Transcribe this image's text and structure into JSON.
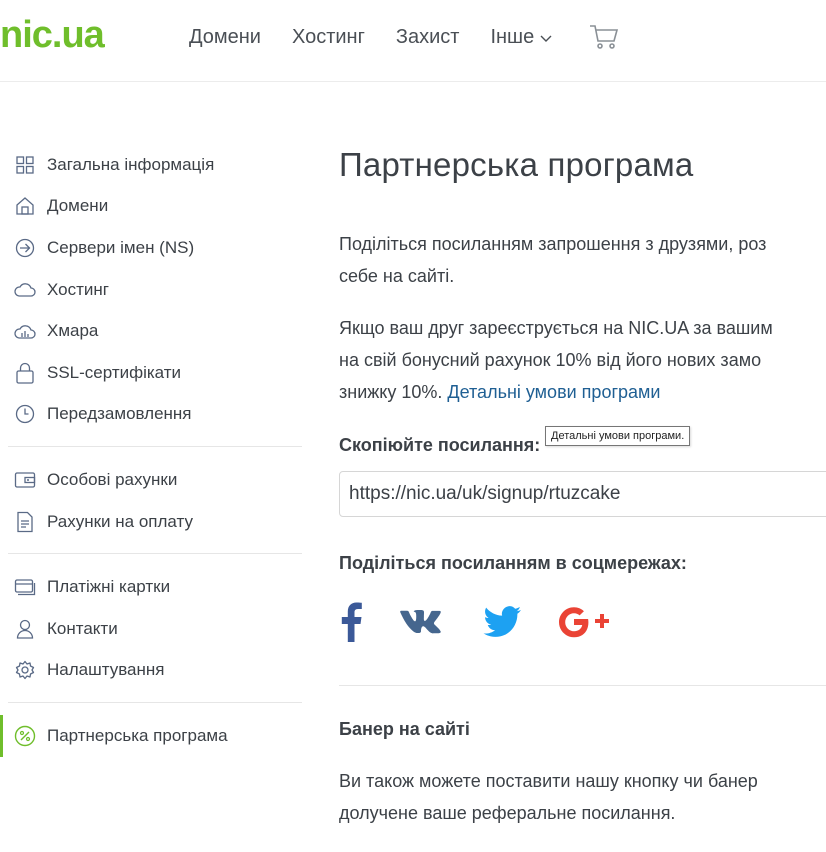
{
  "header": {
    "logo": {
      "left": "nic",
      "dot": ".",
      "right": "ua"
    },
    "nav": [
      "Домени",
      "Хостинг",
      "Захист",
      "Інше"
    ],
    "cart_icon": "cart-icon"
  },
  "sidebar": {
    "groups": [
      [
        {
          "label": "Загальна інформація",
          "icon": "grid-icon"
        },
        {
          "label": "Домени",
          "icon": "house-icon"
        },
        {
          "label": "Сервери імен (NS)",
          "icon": "arrow-circle-icon"
        },
        {
          "label": "Хостинг",
          "icon": "cloud-icon"
        },
        {
          "label": "Хмара",
          "icon": "cloud-chart-icon"
        },
        {
          "label": "SSL-сертифікати",
          "icon": "lock-icon"
        },
        {
          "label": "Передзамовлення",
          "icon": "clock-icon"
        }
      ],
      [
        {
          "label": "Особові рахунки",
          "icon": "wallet-icon"
        },
        {
          "label": "Рахунки на оплату",
          "icon": "document-icon"
        }
      ],
      [
        {
          "label": "Платіжні картки",
          "icon": "card-icon"
        },
        {
          "label": "Контакти",
          "icon": "user-icon"
        },
        {
          "label": "Налаштування",
          "icon": "gear-icon"
        }
      ],
      [
        {
          "label": "Партнерська програма",
          "icon": "percent-icon",
          "active": true
        }
      ]
    ]
  },
  "main": {
    "title": "Партнерська програма",
    "p1_line1": "Поділіться посиланням запрошення з друзями, роз",
    "p1_line2": "себе на сайті.",
    "p2_line1": "Якщо ваш друг зареєструється на NIC.UA за вашим",
    "p2_line2": "на свій бонусний рахунок 10% від його нових замо",
    "p2_line3_prefix": "знижку 10%. ",
    "p2_link": "Детальні умови програми",
    "copy_heading": "Скопіюйте посилання:",
    "referral_link": "https://nic.ua/uk/signup/rtuzcake",
    "share_heading": "Поділіться посиланням в соцмережах:",
    "social": [
      "facebook-icon",
      "vk-icon",
      "twitter-icon",
      "google-plus-icon"
    ],
    "banner_heading": "Банер на сайті",
    "p3_line1": "Ви також можете поставити нашу кнопку чи банер",
    "p3_line2": "долучене ваше реферальне посилання."
  },
  "tooltip": "Детальні умови програми.",
  "colors": {
    "brand": "#6fbe2b",
    "link": "#1f5f93",
    "facebook": "#3b5998",
    "vk": "#45668e",
    "twitter": "#1da1f2",
    "google": "#ea4335"
  }
}
